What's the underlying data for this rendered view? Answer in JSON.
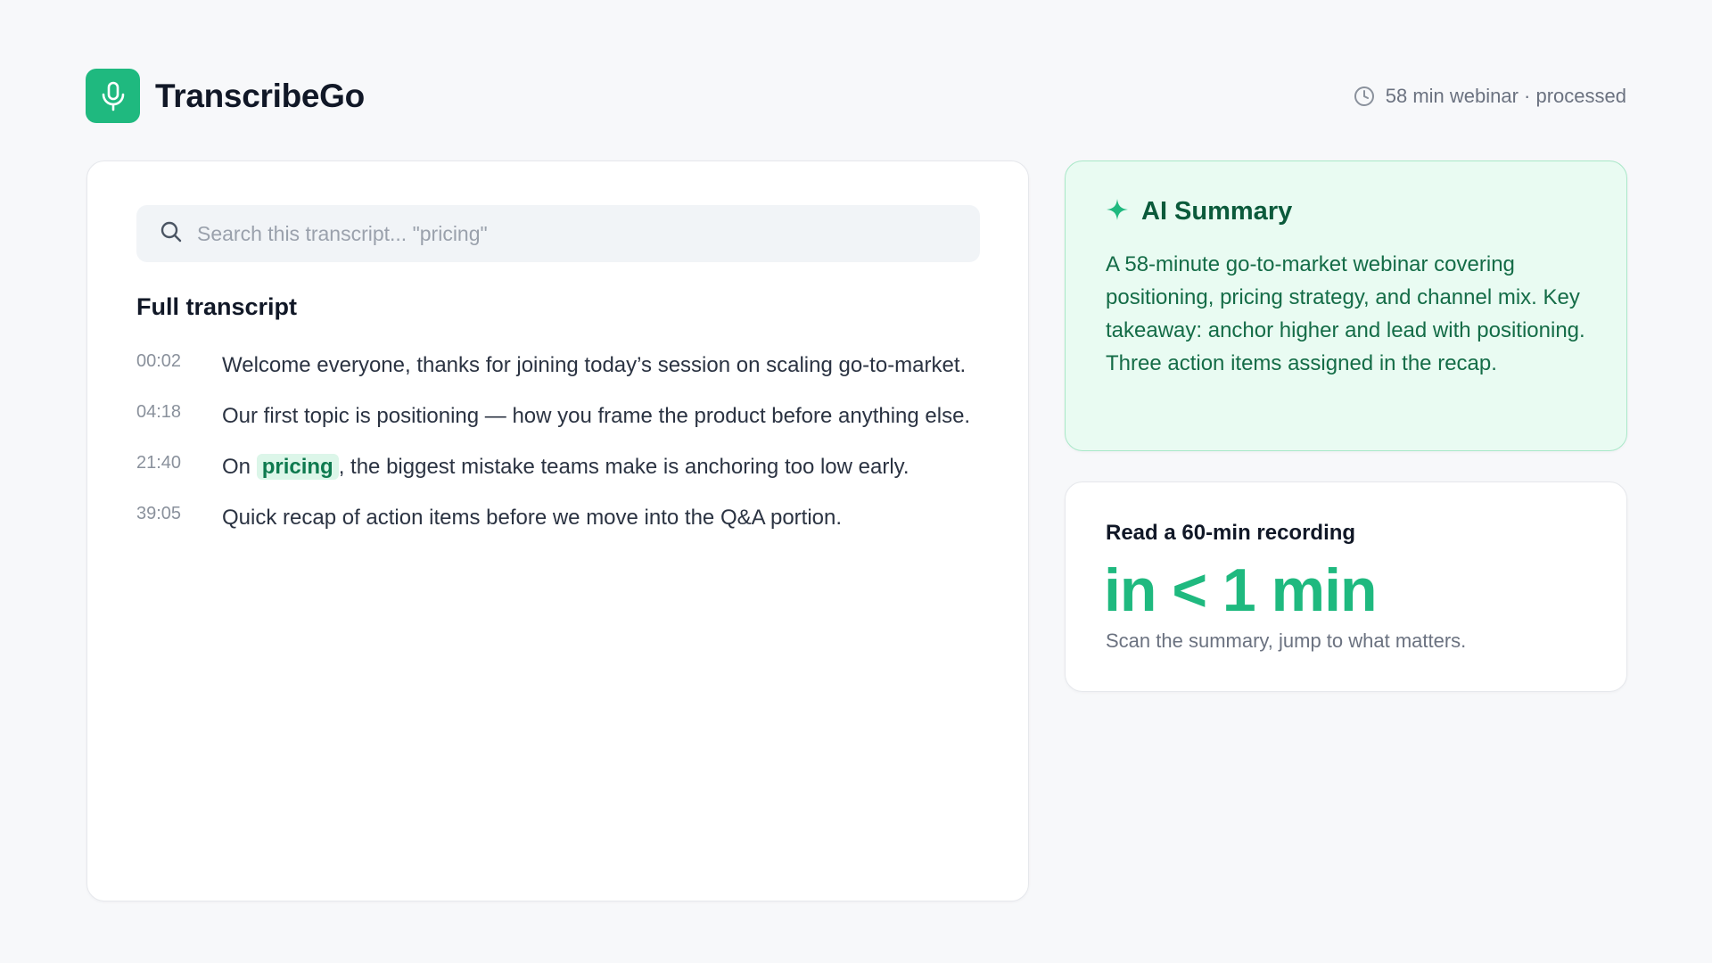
{
  "app": {
    "name": "TranscribeGo",
    "logo_icon": "microphone-icon",
    "accent_color": "#1fb97f"
  },
  "status": {
    "icon": "clock-icon",
    "text": "58 min webinar · processed"
  },
  "search": {
    "placeholder": "Search this transcript... \"pricing\"",
    "icon": "search-icon"
  },
  "transcript": {
    "title": "Full transcript",
    "lines": [
      {
        "time": "00:02",
        "text": "Welcome everyone, thanks for joining today’s session on scaling go-to-market."
      },
      {
        "time": "04:18",
        "text": "Our first topic is positioning — how you frame the product before anything else."
      },
      {
        "time": "21:40",
        "before": "On",
        "highlight": "pricing",
        "after": ", the biggest mistake teams make is anchoring too low early."
      },
      {
        "time": "39:05",
        "text": "Quick recap of action items before we move into the Q&A portion."
      }
    ]
  },
  "summary": {
    "icon": "sparkle-icon",
    "title": "AI Summary",
    "body": "A 58-minute go-to-market webinar covering positioning, pricing strategy, and channel mix. Key takeaway: anchor higher and lead with positioning. Three action items assigned in the recap."
  },
  "stat": {
    "label": "Read a 60-min recording",
    "value": "in < 1 min",
    "subtext": "Scan the summary, jump to what matters."
  }
}
